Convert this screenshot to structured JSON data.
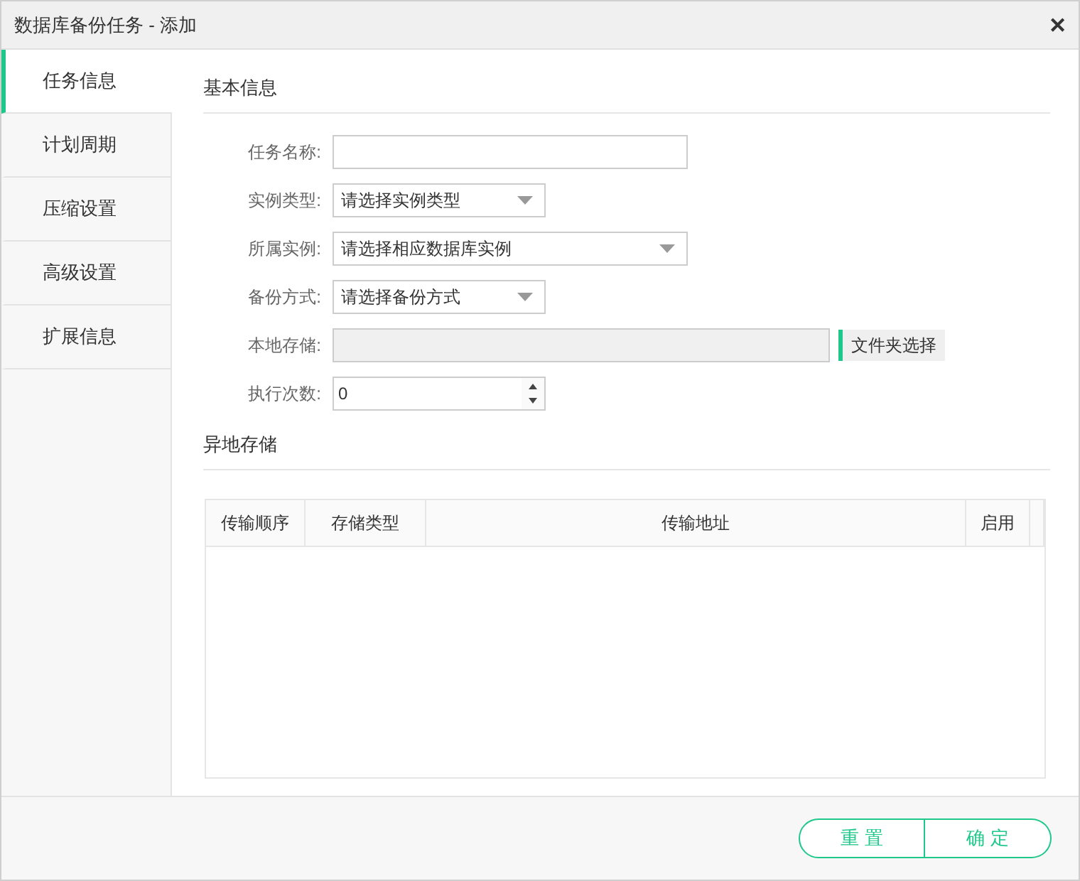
{
  "window": {
    "title": "数据库备份任务 - 添加",
    "close": "✕"
  },
  "sidebar": {
    "items": [
      {
        "label": "任务信息",
        "selected": true
      },
      {
        "label": "计划周期",
        "selected": false
      },
      {
        "label": "压缩设置",
        "selected": false
      },
      {
        "label": "高级设置",
        "selected": false
      },
      {
        "label": "扩展信息",
        "selected": false
      }
    ]
  },
  "basic_section": {
    "title": "基本信息",
    "fields": [
      {
        "kind": "text",
        "label": "任务名称:"
      },
      {
        "kind": "select",
        "label": "实例类型:",
        "value": "请选择实例类型",
        "wide": false
      },
      {
        "kind": "select",
        "label": "所属实例:",
        "value": "请选择相应数据库实例",
        "wide": true
      },
      {
        "kind": "select",
        "label": "备份方式:",
        "value": "请选择备份方式",
        "wide": false
      },
      {
        "kind": "folder",
        "label": "本地存储:",
        "disabled": true,
        "button": "文件夹选择"
      },
      {
        "kind": "number",
        "label": "执行次数:",
        "value": "0"
      }
    ]
  },
  "remote_section": {
    "title": "异地存储",
    "table": {
      "columns": [
        "传输顺序",
        "存储类型",
        "传输地址",
        "启用"
      ]
    }
  },
  "buttons": [
    "重 置",
    "确 定"
  ]
}
